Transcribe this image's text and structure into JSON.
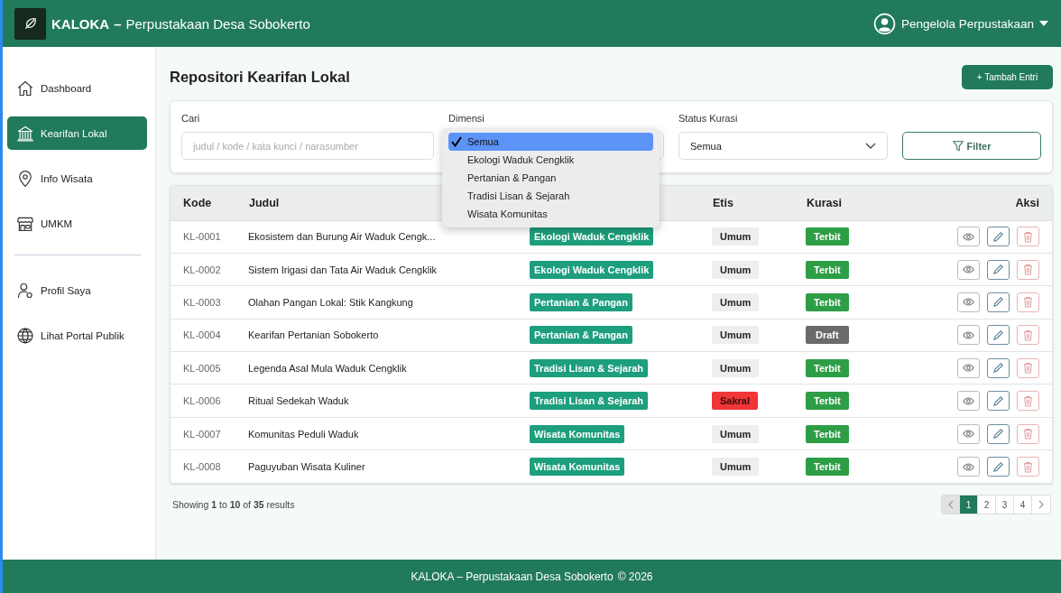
{
  "header": {
    "brand": "KALOKA",
    "separator": "–",
    "subtitle": "Perpustakaan Desa Sobokerto",
    "user": "Pengelola Perpustakaan"
  },
  "sidebar": {
    "groups": [
      [
        {
          "label": "Dashboard",
          "kind": "house",
          "selected": false
        },
        {
          "label": "Kearifan Lokal",
          "kind": "museum",
          "selected": true
        },
        {
          "label": "Info Wisata",
          "kind": "pin",
          "selected": false
        },
        {
          "label": "UMKM",
          "kind": "store",
          "selected": false
        }
      ],
      [
        {
          "label": "Profil Saya",
          "kind": "user",
          "selected": false
        },
        {
          "label": "Lihat Portal Publik",
          "kind": "globe",
          "selected": false
        }
      ]
    ]
  },
  "page_title": "Repositori Kearifan Lokal",
  "add_button": "+ Tambah Entri",
  "filters": {
    "search": {
      "label": "Cari",
      "placeholder": "judul / kode / kata kunci / narasumber"
    },
    "dimension": {
      "label": "Dimensi",
      "expanded": true,
      "options": [
        {
          "label": "Semua",
          "selected": true
        },
        {
          "label": "Ekologi Waduk Cengklik",
          "selected": false
        },
        {
          "label": "Pertanian & Pangan",
          "selected": false
        },
        {
          "label": "Tradisi Lisan & Sejarah",
          "selected": false
        },
        {
          "label": "Wisata Komunitas",
          "selected": false
        }
      ]
    },
    "status": {
      "label": "Status Kurasi",
      "value": "Semua"
    },
    "filter_button": "Filter"
  },
  "table": {
    "columns": [
      "Kode",
      "Judul",
      "Etis",
      "Kurasi",
      "Aksi"
    ],
    "rows": [
      {
        "code": "KL-0001",
        "title": "Ekosistem dan Burung Air Waduk Cengk...",
        "dimension": "Ekologi Waduk Cengklik",
        "ethics": {
          "label": "Umum",
          "kind": "general"
        },
        "curation": {
          "label": "Terbit",
          "kind": "published"
        }
      },
      {
        "code": "KL-0002",
        "title": "Sistem Irigasi dan Tata Air Waduk Cengklik",
        "dimension": "Ekologi Waduk Cengklik",
        "ethics": {
          "label": "Umum",
          "kind": "general"
        },
        "curation": {
          "label": "Terbit",
          "kind": "published"
        }
      },
      {
        "code": "KL-0003",
        "title": "Olahan Pangan Lokal: Stik Kangkung",
        "dimension": "Pertanian & Pangan",
        "ethics": {
          "label": "Umum",
          "kind": "general"
        },
        "curation": {
          "label": "Terbit",
          "kind": "published"
        }
      },
      {
        "code": "KL-0004",
        "title": "Kearifan Pertanian Sobokerto",
        "dimension": "Pertanian & Pangan",
        "ethics": {
          "label": "Umum",
          "kind": "general"
        },
        "curation": {
          "label": "Draft",
          "kind": "draft"
        }
      },
      {
        "code": "KL-0005",
        "title": "Legenda Asal Mula Waduk Cengklik",
        "dimension": "Tradisi Lisan & Sejarah",
        "ethics": {
          "label": "Umum",
          "kind": "general"
        },
        "curation": {
          "label": "Terbit",
          "kind": "published"
        }
      },
      {
        "code": "KL-0006",
        "title": "Ritual Sedekah Waduk",
        "dimension": "Tradisi Lisan & Sejarah",
        "ethics": {
          "label": "Sakral",
          "kind": "sacred"
        },
        "curation": {
          "label": "Terbit",
          "kind": "published"
        }
      },
      {
        "code": "KL-0007",
        "title": "Komunitas Peduli Waduk",
        "dimension": "Wisata Komunitas",
        "ethics": {
          "label": "Umum",
          "kind": "general"
        },
        "curation": {
          "label": "Terbit",
          "kind": "published"
        }
      },
      {
        "code": "KL-0008",
        "title": "Paguyuban Wisata Kuliner",
        "dimension": "Wisata Komunitas",
        "ethics": {
          "label": "Umum",
          "kind": "general"
        },
        "curation": {
          "label": "Terbit",
          "kind": "published"
        }
      }
    ]
  },
  "summary": "Showing **1** to **10** of **35** results",
  "pagination": {
    "pages": [
      {
        "label": "1",
        "selected": true
      },
      {
        "label": "2",
        "selected": false
      },
      {
        "label": "3",
        "selected": false
      },
      {
        "label": "4",
        "selected": false
      }
    ]
  },
  "footer": {
    "text": "KALOKA – Perpustakaan Desa Sobokerto",
    "copyright": "© 2026"
  }
}
